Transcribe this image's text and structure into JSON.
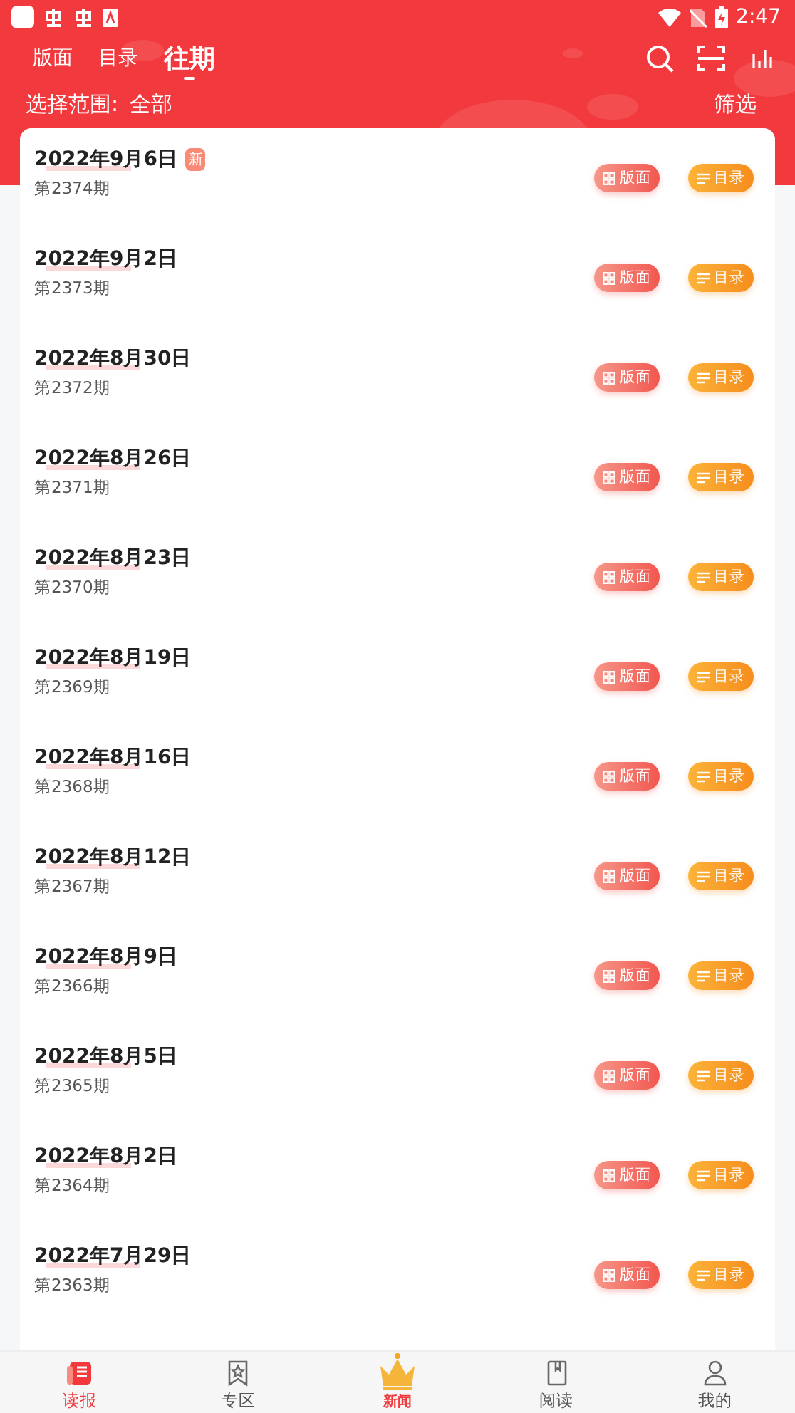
{
  "status_bar": {
    "time": "2:47"
  },
  "tabs": [
    {
      "label": "版面",
      "selected": false
    },
    {
      "label": "目录",
      "selected": false
    },
    {
      "label": "往期",
      "selected": true
    }
  ],
  "range": {
    "label": "选择范围:",
    "value": "全部"
  },
  "filter": "筛选",
  "issues": [
    {
      "date": "2022年9月6日",
      "issue": "第2374期",
      "badge": "新",
      "buttons": [
        "版面",
        "目录"
      ]
    },
    {
      "date": "2022年9月2日",
      "issue": "第2373期",
      "buttons": [
        "版面",
        "目录"
      ]
    },
    {
      "date": "2022年8月30日",
      "issue": "第2372期",
      "buttons": [
        "版面",
        "目录"
      ]
    },
    {
      "date": "2022年8月26日",
      "issue": "第2371期",
      "buttons": [
        "版面",
        "目录"
      ]
    },
    {
      "date": "2022年8月23日",
      "issue": "第2370期",
      "buttons": [
        "版面",
        "目录"
      ]
    },
    {
      "date": "2022年8月19日",
      "issue": "第2369期",
      "buttons": [
        "版面",
        "目录"
      ]
    },
    {
      "date": "2022年8月16日",
      "issue": "第2368期",
      "buttons": [
        "版面",
        "目录"
      ]
    },
    {
      "date": "2022年8月12日",
      "issue": "第2367期",
      "buttons": [
        "版面",
        "目录"
      ]
    },
    {
      "date": "2022年8月9日",
      "issue": "第2366期",
      "buttons": [
        "版面",
        "目录"
      ]
    },
    {
      "date": "2022年8月5日",
      "issue": "第2365期",
      "buttons": [
        "版面",
        "目录"
      ]
    },
    {
      "date": "2022年8月2日",
      "issue": "第2364期",
      "buttons": [
        "版面",
        "目录"
      ]
    },
    {
      "date": "2022年7月29日",
      "issue": "第2363期",
      "buttons": [
        "版面",
        "目录"
      ]
    }
  ],
  "nav": [
    {
      "kind": "paper",
      "label": "读报",
      "selected": true
    },
    {
      "kind": "zone",
      "label": "专区",
      "selected": false
    },
    {
      "kind": "crown",
      "label": "新闻",
      "selected": false
    },
    {
      "kind": "book",
      "label": "阅读",
      "selected": false
    },
    {
      "kind": "user",
      "label": "我的",
      "selected": false
    }
  ]
}
